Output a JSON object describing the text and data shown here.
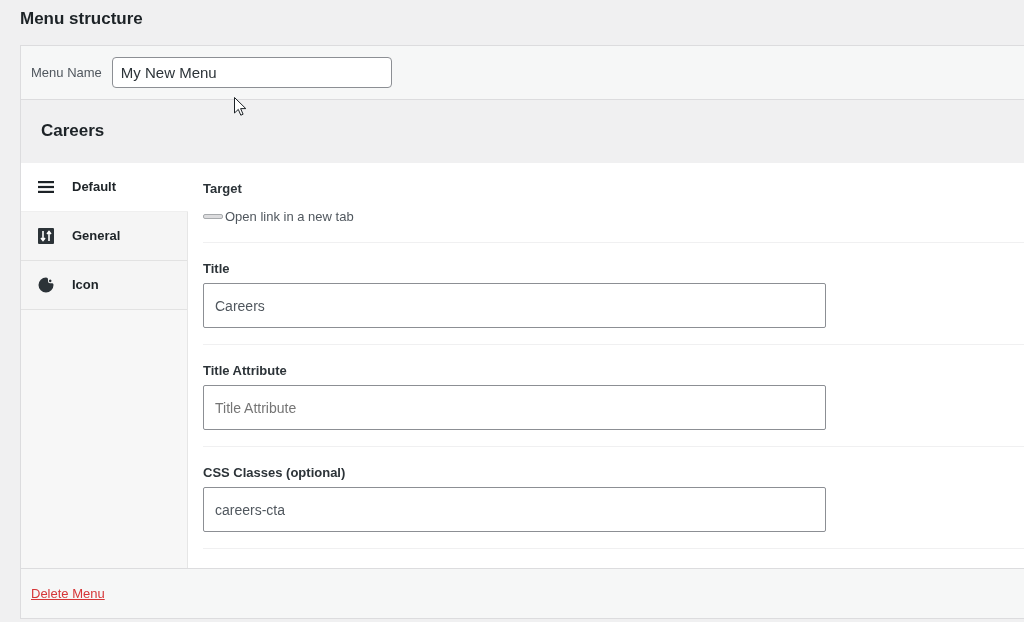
{
  "page_title": "Menu structure",
  "menu_name": {
    "label": "Menu Name",
    "value": "My New Menu"
  },
  "item": {
    "title": "Careers",
    "tabs": [
      {
        "label": "Default",
        "selected": true
      },
      {
        "label": "General",
        "selected": false
      },
      {
        "label": "Icon",
        "selected": false
      }
    ],
    "fields": [
      {
        "kind": "toggle",
        "label": "Target",
        "option": "Open link in a new tab",
        "checked": false
      },
      {
        "kind": "text",
        "label": "Title",
        "value": "Careers"
      },
      {
        "kind": "text",
        "label": "Title Attribute",
        "placeholder": "Title Attribute"
      },
      {
        "kind": "text",
        "label": "CSS Classes (optional)",
        "value": "careers-cta"
      }
    ]
  },
  "footer": {
    "delete_link": "Delete Menu"
  }
}
